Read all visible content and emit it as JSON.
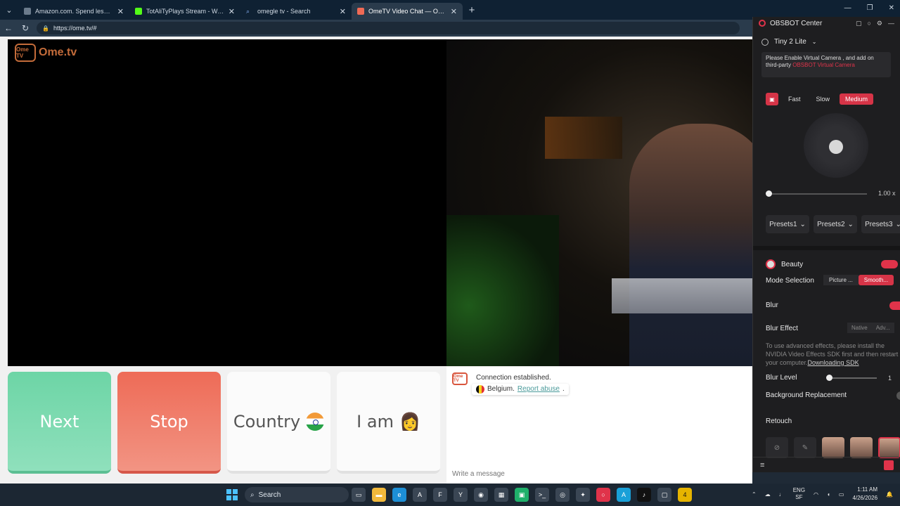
{
  "browser": {
    "tabs": [
      {
        "title": "Amazon.com. Spend less. Smile more.",
        "fav_color": "#6b7b8c",
        "active": false
      },
      {
        "title": "TotAliTyPlays Stream - Watch Live",
        "fav_color": "#53fc18",
        "active": false
      },
      {
        "title": "omegle tv - Search",
        "fav_color": "#1e88e5",
        "active": false
      },
      {
        "title": "OmeTV Video Chat — Omegle",
        "fav_color": "#f06a55",
        "active": true
      }
    ],
    "url": "https://ome.tv/#"
  },
  "page": {
    "logo_box": "Ome TV",
    "logo_text": "Ome.tv",
    "buttons": {
      "next": "Next",
      "stop": "Stop",
      "country": "Country",
      "iam": "I am"
    },
    "chat": {
      "logo": "Ome TV",
      "status": "Connection established.",
      "country": "Belgium.",
      "report": "Report abuse",
      "report_suffix": ".",
      "input_placeholder": "Write a message"
    }
  },
  "obsbot": {
    "title": "OBSBOT Center",
    "device": "Tiny 2 Lite",
    "notice_text": "Please Enable Virtual Camera , and add on third-party ",
    "notice_link": "OBSBOT Virtual Camera",
    "speeds": [
      "Fast",
      "Slow",
      "Medium"
    ],
    "zoom_value": "1.00 x",
    "zoom_level": 0.0,
    "presets": [
      "Presets1",
      "Presets2",
      "Presets3"
    ],
    "beauty_label": "Beauty",
    "mode_label": "Mode Selection",
    "modes": [
      "Picture ...",
      "Smooth..."
    ],
    "blur_label": "Blur",
    "blur_effect_label": "Blur Effect",
    "blur_effects": [
      "Native",
      "Adv..."
    ],
    "sdk_message": "To use advanced effects, please install the NVIDIA Video Effects SDK first and then restart your computer.",
    "sdk_link": "Downloading SDK",
    "blur_level_label": "Blur Level",
    "blur_level_value": "1",
    "bg_replacement_label": "Background Replacement",
    "retouch_label": "Retouch"
  },
  "taskbar": {
    "search_label": "Search",
    "lang_top": "ENG",
    "lang_bottom": "SF",
    "time": "1:11 AM",
    "date": "4/26/2026",
    "notification_count": "4"
  },
  "colors": {
    "next": "#6dd5a6",
    "stop": "#ee6b57",
    "obs_accent": "#e0334a"
  }
}
